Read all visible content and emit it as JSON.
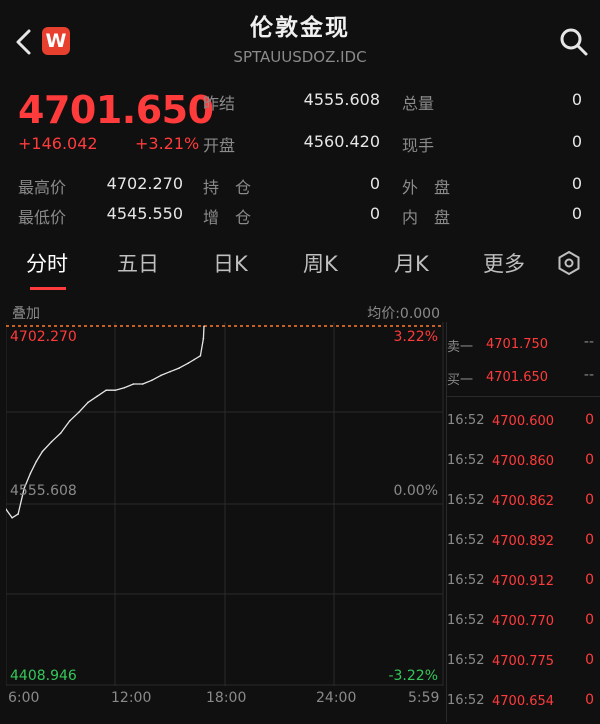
{
  "header": {
    "title": "伦敦金现",
    "code": "SPTAUUSDOZ.IDC",
    "logo_letter": "W"
  },
  "quote": {
    "price": "4701.650",
    "change": "+146.042",
    "change_pct": "+3.21%",
    "stats": [
      {
        "label": "昨结",
        "value": "4555.608"
      },
      {
        "label": "总量",
        "value": "0"
      },
      {
        "label": "开盘",
        "value": "4560.420"
      },
      {
        "label": "现手",
        "value": "0"
      },
      {
        "label": "最高价",
        "value": "4702.270"
      },
      {
        "label": "持　仓",
        "value": "0"
      },
      {
        "label": "外　盘",
        "value": "0"
      },
      {
        "label": "最低价",
        "value": "4545.550"
      },
      {
        "label": "增　仓",
        "value": "0"
      },
      {
        "label": "内　盘",
        "value": "0"
      }
    ]
  },
  "tabs": [
    "分时",
    "五日",
    "日K",
    "周K",
    "月K",
    "更多"
  ],
  "chart_labels": {
    "overlay": "叠加",
    "avg_price": "均价:0.000",
    "y_top": "4702.270",
    "y_mid": "4555.608",
    "y_bottom": "4408.946",
    "pct_top": "3.22%",
    "pct_mid": "0.00%",
    "pct_bottom": "-3.22%",
    "times": [
      "6:00",
      "12:00",
      "18:00",
      "24:00",
      "5:59"
    ]
  },
  "chart_data": {
    "type": "line",
    "title": "",
    "xlabel": "",
    "ylabel": "",
    "x_ticks": [
      "6:00",
      "12:00",
      "18:00",
      "24:00",
      "5:59"
    ],
    "ylim": [
      4408.946,
      4702.27
    ],
    "reference": 4555.608,
    "series": [
      {
        "x": [
          "6:00",
          "6:20",
          "6:40",
          "7:00",
          "7:20",
          "7:40",
          "8:00",
          "8:30",
          "9:00",
          "9:30",
          "10:00",
          "10:30",
          "11:00",
          "11:30",
          "12:00",
          "12:30",
          "13:00",
          "13:30",
          "14:00",
          "14:30",
          "15:00",
          "15:30",
          "16:00",
          "16:20",
          "16:40",
          "16:50",
          "16:52"
        ],
        "values": [
          4553,
          4546,
          4549,
          4570,
          4582,
          4592,
          4600,
          4608,
          4615,
          4625,
          4632,
          4640,
          4645,
          4650,
          4650,
          4652,
          4655,
          4655,
          4658,
          4662,
          4665,
          4668,
          4672,
          4675,
          4678,
          4692,
          4702
        ]
      }
    ]
  },
  "order_book": {
    "asks": [
      {
        "label": "卖一",
        "price": "4701.750",
        "vol": "--"
      }
    ],
    "bids": [
      {
        "label": "买一",
        "price": "4701.650",
        "vol": "--"
      }
    ],
    "trades": [
      {
        "time": "16:52",
        "price": "4700.600",
        "vol": "0"
      },
      {
        "time": "16:52",
        "price": "4700.860",
        "vol": "0"
      },
      {
        "time": "16:52",
        "price": "4700.862",
        "vol": "0"
      },
      {
        "time": "16:52",
        "price": "4700.892",
        "vol": "0"
      },
      {
        "time": "16:52",
        "price": "4700.912",
        "vol": "0"
      },
      {
        "time": "16:52",
        "price": "4700.770",
        "vol": "0"
      },
      {
        "time": "16:52",
        "price": "4700.775",
        "vol": "0"
      },
      {
        "time": "16:52",
        "price": "4700.654",
        "vol": "0"
      }
    ]
  },
  "colors": {
    "up": "#ff3b3b",
    "down": "#35c759",
    "line": "#e6e6e6",
    "background": "#101010"
  }
}
